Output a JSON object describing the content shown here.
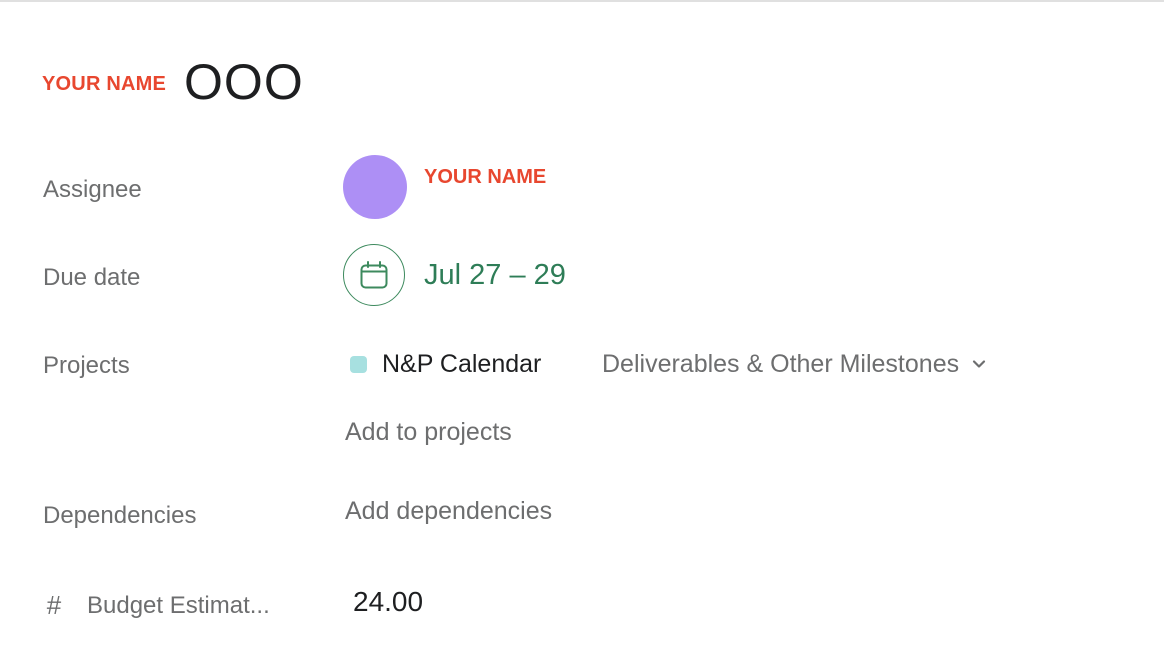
{
  "task": {
    "title_tag": "YOUR NAME",
    "title": "OOO"
  },
  "labels": {
    "assignee": "Assignee",
    "due_date": "Due date",
    "projects": "Projects",
    "dependencies": "Dependencies",
    "budget": "Budget Estimat..."
  },
  "assignee": {
    "name": "YOUR NAME"
  },
  "due_date": {
    "value": "Jul 27 – 29"
  },
  "projects": {
    "name": "N&P Calendar",
    "section": "Deliverables & Other Milestones",
    "add_label": "Add to projects"
  },
  "dependencies": {
    "add_label": "Add dependencies"
  },
  "budget": {
    "value": "24.00"
  },
  "icons": {
    "calendar": "calendar-icon",
    "chevron": "chevron-down-icon",
    "hash": "hash-icon"
  },
  "colors": {
    "accent_red": "#e8472f",
    "avatar": "#ad8ff5",
    "due_green": "#2e7d57",
    "project_swatch": "#a7e0e0"
  }
}
